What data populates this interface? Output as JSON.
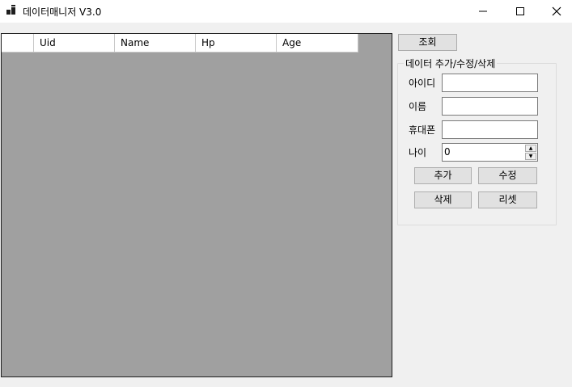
{
  "window": {
    "title": "데이터매니저 V3.0",
    "controls": {
      "minimize": "─",
      "maximize": "☐",
      "close": "✕"
    }
  },
  "grid": {
    "columns": [
      "",
      "Uid",
      "Name",
      "Hp",
      "Age"
    ],
    "rows": []
  },
  "toolbar": {
    "query_label": "조회"
  },
  "form": {
    "group_title": "데이터 추가/수정/삭제",
    "id_label": "아이디",
    "id_value": "",
    "name_label": "이름",
    "name_value": "",
    "phone_label": "휴대폰",
    "phone_value": "",
    "age_label": "나이",
    "age_value": "0",
    "add_label": "추가",
    "edit_label": "수정",
    "delete_label": "삭제",
    "reset_label": "리셋"
  },
  "colors": {
    "grid_background": "#a0a0a0",
    "client_background": "#f0f0f0",
    "button_face": "#e1e1e1"
  }
}
